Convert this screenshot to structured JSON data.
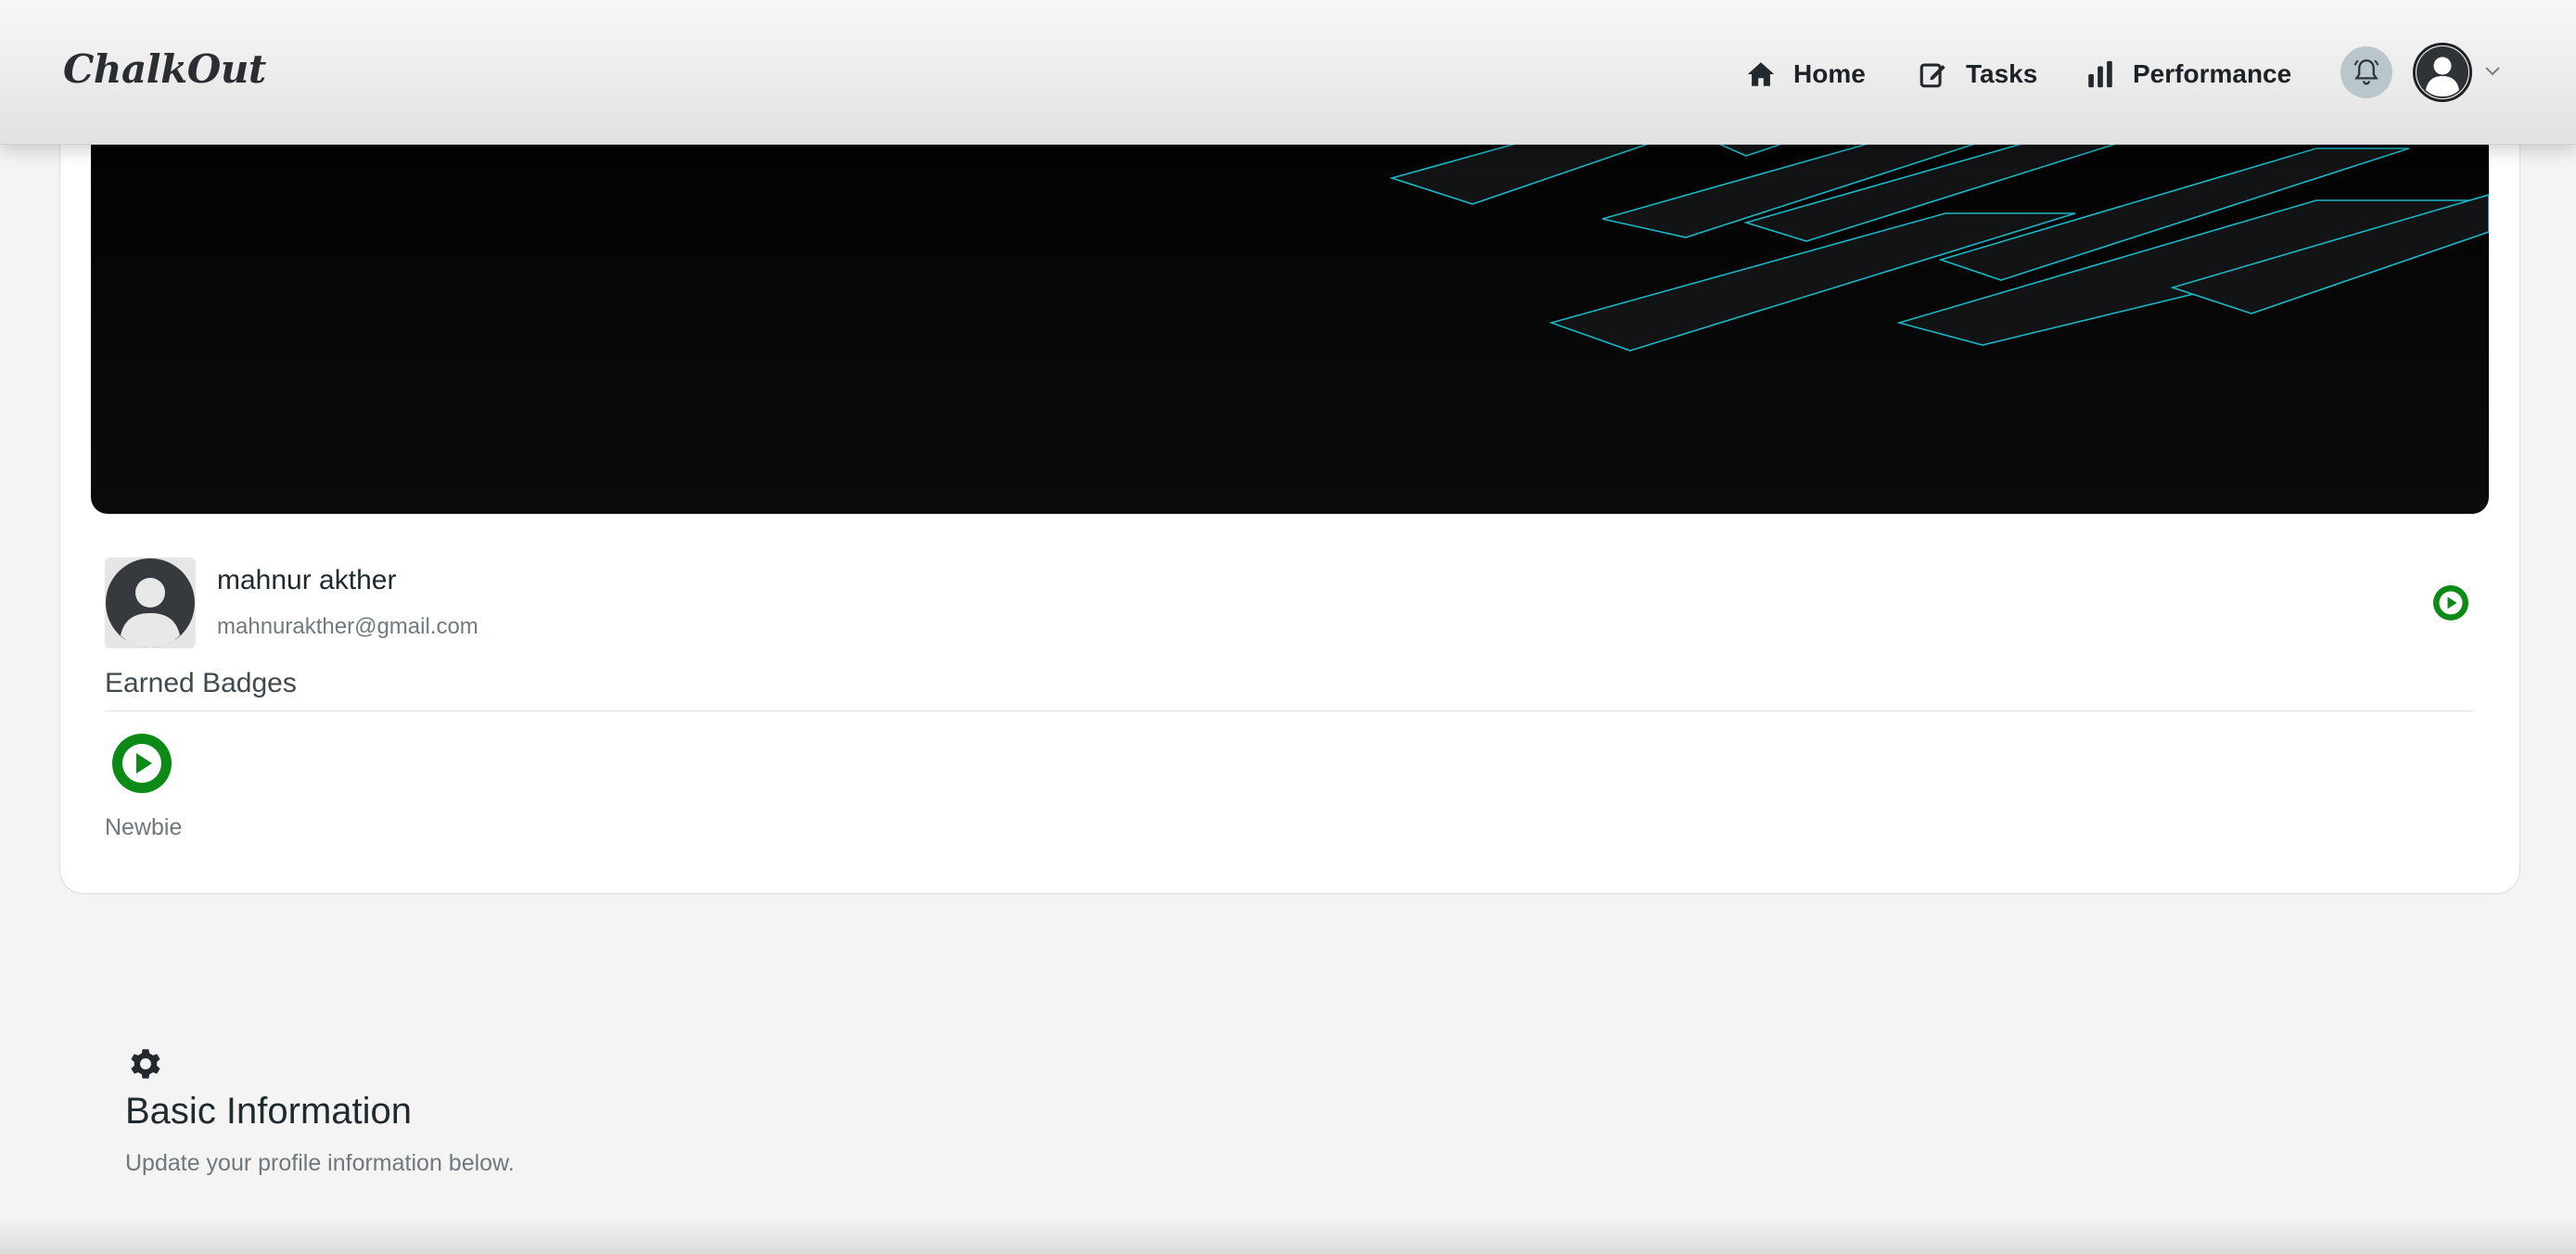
{
  "app": {
    "logo": "ChalkOut"
  },
  "nav": {
    "home_label": "Home",
    "tasks_label": "Tasks",
    "performance_label": "Performance"
  },
  "header_icons": {
    "notifications": "bell-icon",
    "account": "user-avatar-icon",
    "menu": "chevron-down-icon"
  },
  "profile": {
    "name": "mahnur akther",
    "email": "mahnurakther@gmail.com",
    "badge_icon": "play-circle-icon"
  },
  "badges": {
    "title": "Earned Badges",
    "items": [
      {
        "label": "Newbie",
        "icon": "play-circle-icon"
      }
    ]
  },
  "basic_info": {
    "icon": "gear-icon",
    "title": "Basic Information",
    "subtitle": "Update your profile information below."
  },
  "colors": {
    "badge_green": "#0b8a16",
    "banner_accent": "#19b8c4",
    "banner_bg": "#050505"
  }
}
